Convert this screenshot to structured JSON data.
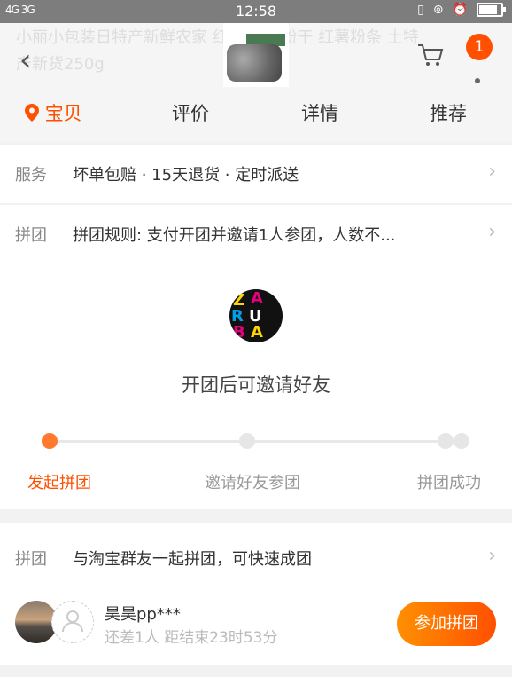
{
  "status_bar": {
    "signal": "4G 3G",
    "time": "12:58"
  },
  "header": {
    "title_partial": "小丽小包装日特产新鲜农家 红薯粉丝 粉干 红薯粉条 土特产新货250g",
    "cart_badge": "1"
  },
  "tabs": [
    {
      "label": "宝贝",
      "active": true
    },
    {
      "label": "评价",
      "active": false
    },
    {
      "label": "详情",
      "active": false
    },
    {
      "label": "推荐",
      "active": false
    }
  ],
  "service": {
    "key": "服务",
    "value": "坏单包赔 · 15天退货 · 定时派送"
  },
  "group_rule": {
    "key": "拼团",
    "value": "拼团规则: 支付开团并邀请1人参团，人数不..."
  },
  "group_progress": {
    "invite_text": "开团后可邀请好友",
    "steps": [
      {
        "label": "发起拼团",
        "active": true
      },
      {
        "label": "邀请好友参团",
        "active": false
      },
      {
        "label": "拼团成功",
        "active": false
      }
    ]
  },
  "group_join": {
    "key": "拼团",
    "value": "与淘宝群友一起拼团，可快速成团",
    "user_name": "昊昊pp***",
    "remaining": "还差1人 距结束23时53分",
    "button_label": "参加拼团"
  },
  "colors": {
    "accent": "#ff5000",
    "accent_light": "#ff9000"
  }
}
